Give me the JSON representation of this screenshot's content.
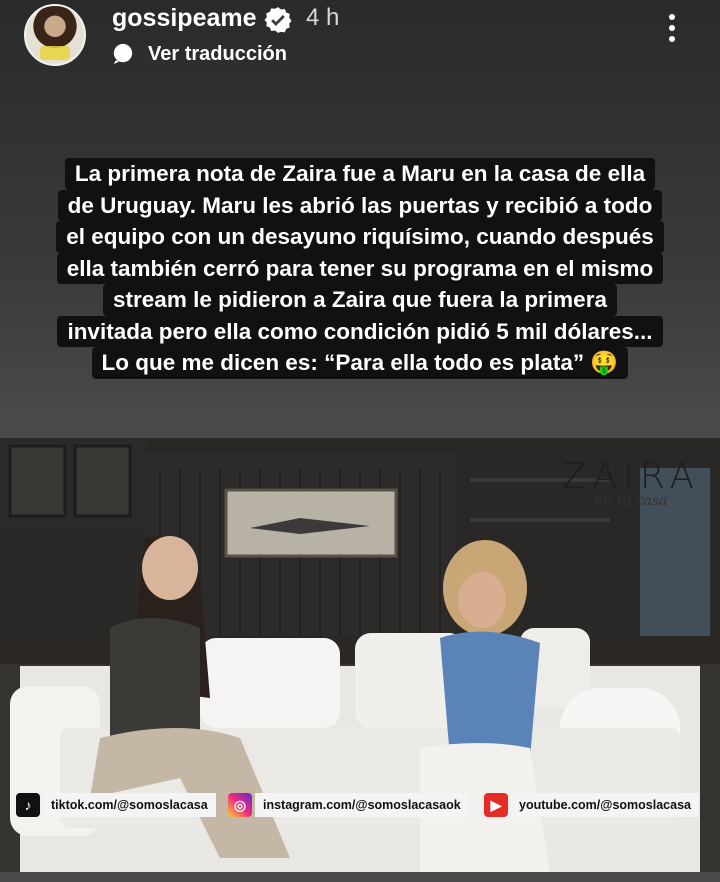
{
  "header": {
    "username": "gossipeame",
    "time": "4 h",
    "translate_label": "Ver traducción",
    "verified_color": "#ffffff"
  },
  "caption": {
    "lines": [
      "La primera nota de Zaira fue a Maru en la casa de ella",
      "de Uruguay. Maru les abrió las puertas y recibió a todo",
      "el equipo con un desayuno riquísimo, cuando después",
      "ella también cerró para tener su programa en el mismo",
      "stream le pidieron a Zaira que fuera la primera",
      "invitada pero ella como condición pidió 5 mil dólares...",
      "Lo que me dicen es: “Para ella todo es plata” 🤑"
    ]
  },
  "video": {
    "watermark_title": "ZAIRA",
    "watermark_subtitle": "en tu casa",
    "socials": [
      {
        "icon": "tiktok-icon",
        "text": "tiktok.com/@somoslacasa"
      },
      {
        "icon": "instagram-icon",
        "text": "instagram.com/@somoslacasaok"
      },
      {
        "icon": "youtube-icon",
        "text": "youtube.com/@somoslacasa"
      }
    ]
  },
  "colors": {
    "caption_bg": "#111111",
    "youtube_red": "#e52d27",
    "tiktok_black": "#111111"
  }
}
